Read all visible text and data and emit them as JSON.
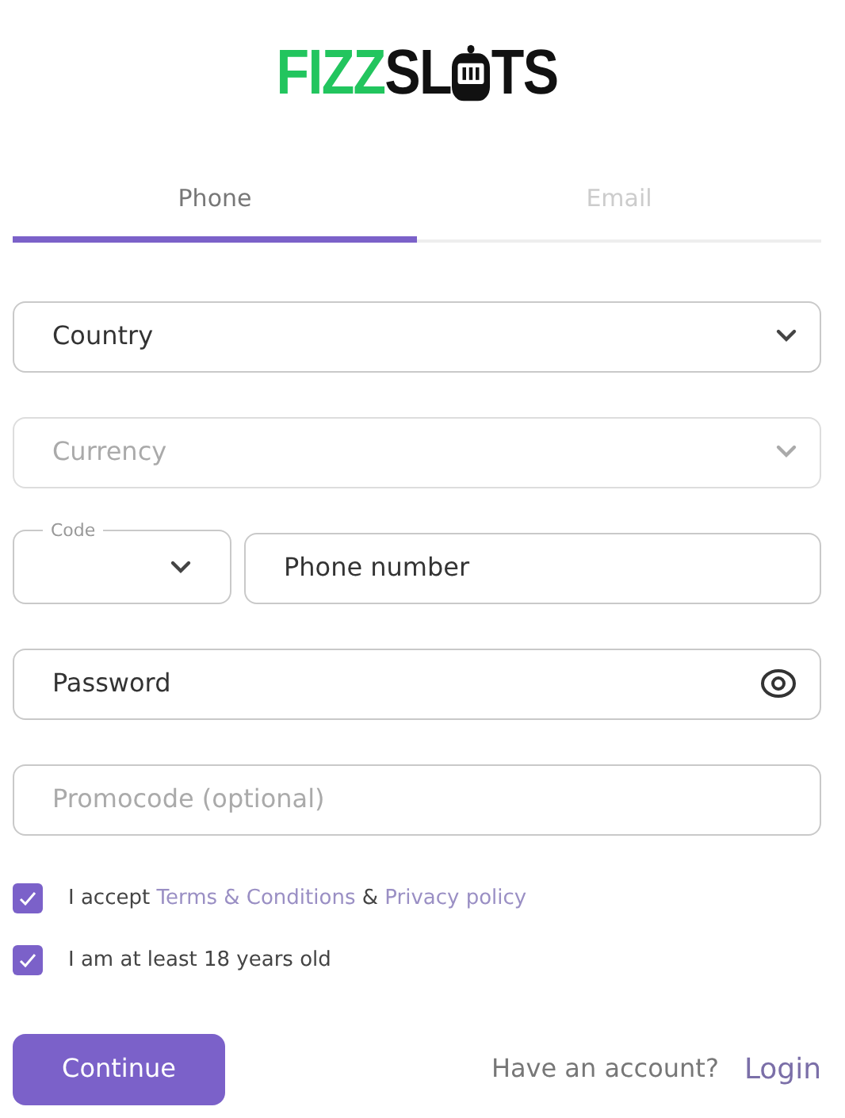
{
  "logo": {
    "first": "FIZZ",
    "second": "SL",
    "third": "TS"
  },
  "tabs": [
    {
      "label": "Phone",
      "selected": true
    },
    {
      "label": "Email",
      "selected": false
    }
  ],
  "fields": [
    {
      "kind": "select",
      "label": "Country",
      "disabled": false
    },
    {
      "kind": "select",
      "placeholder": "Currency",
      "disabled": true
    },
    {
      "kind": "phone",
      "code_label": "Code",
      "label": "Phone number",
      "disabled": false
    },
    {
      "kind": "password",
      "label": "Password",
      "disabled": false
    },
    {
      "kind": "text",
      "placeholder": "Promocode (optional)",
      "disabled": false
    }
  ],
  "checkboxes": [
    {
      "checked": true,
      "parts": [
        {
          "text": "I accept ",
          "link": false
        },
        {
          "text": "Terms & Conditions",
          "link": true
        },
        {
          "text": " & ",
          "link": false
        },
        {
          "text": "Privacy policy",
          "link": true
        }
      ]
    },
    {
      "checked": true,
      "parts": [
        {
          "text": "I am at least 18 years old",
          "link": false
        }
      ]
    }
  ],
  "continue_button": "Continue",
  "account_prompt": "Have an account?",
  "login_link": "Login"
}
